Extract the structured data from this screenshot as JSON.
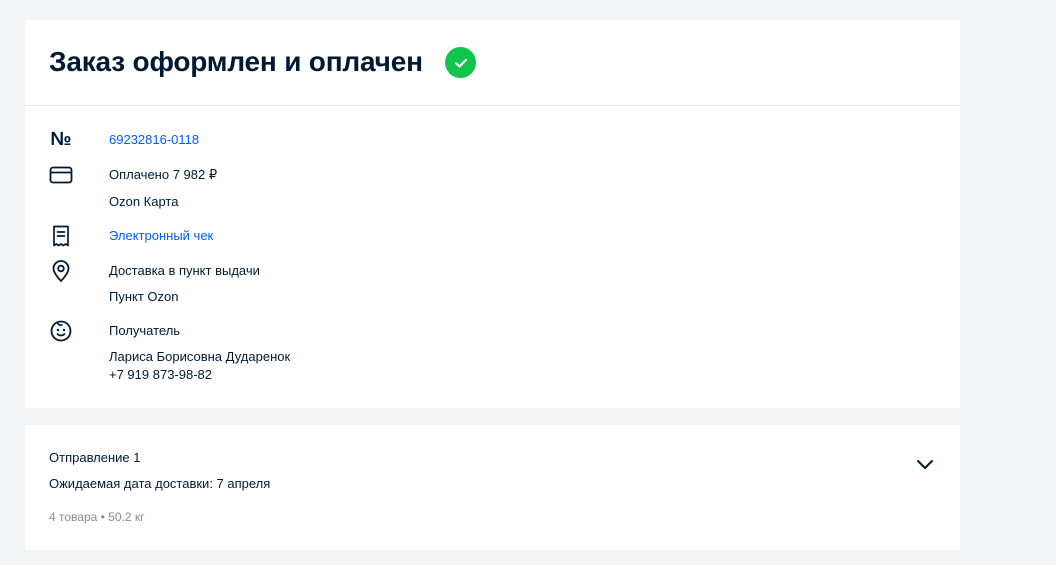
{
  "order": {
    "title": "Заказ оформлен и оплачен",
    "number_symbol": "№",
    "number": "69232816-0118",
    "payment": {
      "label": "Оплачено 7 982 ₽",
      "method": "Ozon Карта"
    },
    "receipt_link": "Электронный чек",
    "delivery": {
      "label": "Доставка в пункт выдачи",
      "point": "Пункт Ozon"
    },
    "recipient": {
      "label": "Получатель",
      "name": "Лариса Борисовна Дударенок",
      "phone": "+7 919 873-98-82"
    }
  },
  "shipment": {
    "title": "Отправление 1",
    "expected_date": "Ожидаемая дата доставки: 7 апреля",
    "meta": "4 товара • 50.2 кг"
  },
  "colors": {
    "accent_link": "#005bff",
    "success": "#10c44c",
    "text": "#001a34",
    "muted": "#808d9a",
    "background": "#f2f3f5"
  },
  "icons": {
    "status": "check-circle-icon",
    "payment": "credit-card-icon",
    "receipt": "receipt-icon",
    "delivery": "map-pin-icon",
    "recipient": "smiley-face-icon",
    "expand": "chevron-down-icon"
  }
}
